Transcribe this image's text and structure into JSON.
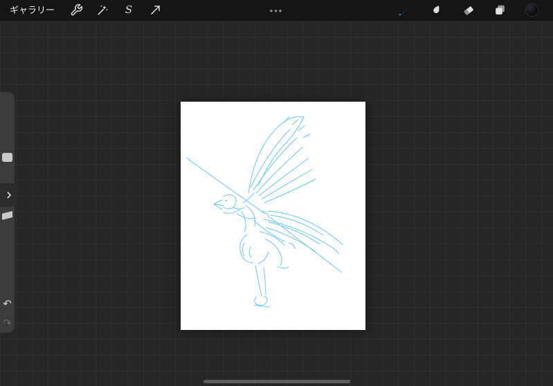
{
  "toolbar": {
    "gallery_label": "ギャラリー",
    "center_menu_label": "•••",
    "selection_glyph": "S",
    "tools_left": [
      {
        "id": "actions",
        "icon": "wrench-icon"
      },
      {
        "id": "adjustments",
        "icon": "magic-wand-icon"
      },
      {
        "id": "selection",
        "icon": "selection-s-icon"
      },
      {
        "id": "transform",
        "icon": "transform-arrow-icon"
      }
    ],
    "tools_right": [
      {
        "id": "paint",
        "icon": "brush-icon",
        "active": true
      },
      {
        "id": "smudge",
        "icon": "smudge-finger-icon",
        "active": false
      },
      {
        "id": "erase",
        "icon": "eraser-icon",
        "active": false
      },
      {
        "id": "layers",
        "icon": "layers-icon",
        "active": false
      },
      {
        "id": "color",
        "icon": "color-swatch",
        "active": false,
        "current_color": "#0a0a0d"
      }
    ],
    "active_tool_color": "#3d9ef5"
  },
  "sidebar": {
    "brush_size_slider": "brush-size",
    "modify_icon": "chevron-right-icon",
    "opacity_slider": "opacity",
    "undo_glyph": "↶",
    "redo_glyph": "↷"
  },
  "canvas": {
    "content": "light blue rough sketch of a winged bird-headed figure holding a long staff",
    "ink_color": "#55c5f2",
    "paper_color": "#ffffff"
  },
  "system": {
    "home_indicator": true
  }
}
